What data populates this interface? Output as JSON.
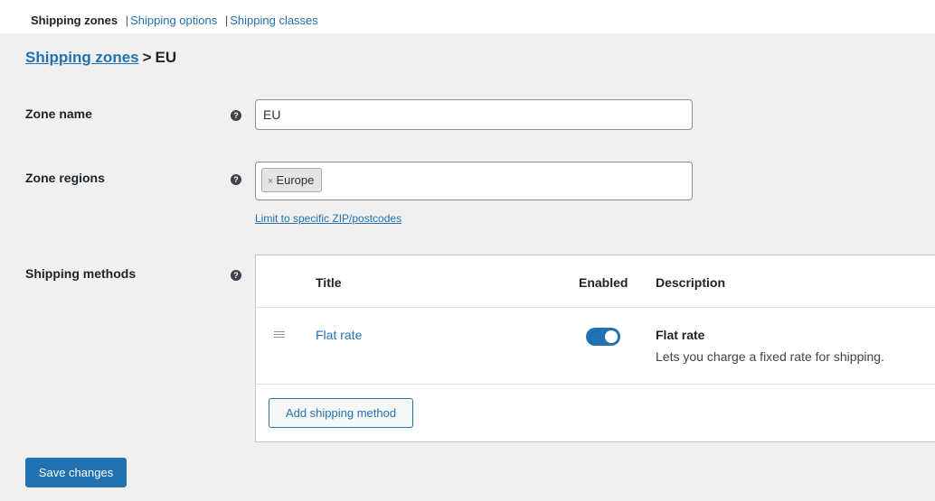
{
  "subnav": {
    "current": "Shipping zones",
    "links": [
      "Shipping options",
      "Shipping classes"
    ]
  },
  "breadcrumb": {
    "link": "Shipping zones",
    "separator": ">",
    "current": "EU"
  },
  "zone_name": {
    "label": "Zone name",
    "value": "EU"
  },
  "zone_regions": {
    "label": "Zone regions",
    "tags": [
      {
        "remove": "×",
        "label": "Europe"
      }
    ],
    "zip_link": "Limit to specific ZIP/postcodes"
  },
  "shipping_methods": {
    "label": "Shipping methods",
    "columns": {
      "title": "Title",
      "enabled": "Enabled",
      "description": "Description"
    },
    "rows": [
      {
        "title": "Flat rate",
        "enabled": true,
        "desc_title": "Flat rate",
        "desc_text": "Lets you charge a fixed rate for shipping."
      }
    ],
    "add_button": "Add shipping method"
  },
  "save_button": "Save changes",
  "colors": {
    "accent": "#2271b1",
    "background": "#f0f0f1"
  },
  "icons": {
    "help": "question-circle-icon",
    "drag": "drag-handle-icon",
    "remove": "close-icon"
  }
}
